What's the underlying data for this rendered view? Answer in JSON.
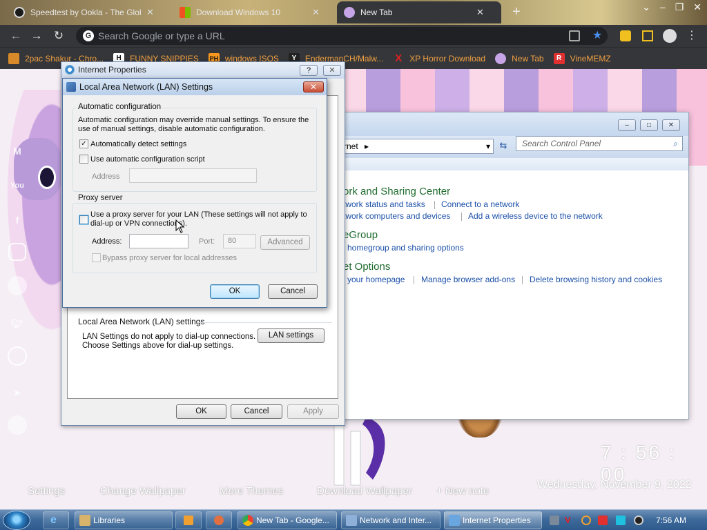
{
  "browser": {
    "tabs": [
      {
        "title": "Speedtest by Ookla - The Globa",
        "close": "✕"
      },
      {
        "title": "Download Windows 10",
        "close": "✕"
      },
      {
        "title": "New Tab",
        "close": "✕"
      }
    ],
    "new_tab": "+",
    "omnibox_placeholder": "Search Google or type a URL",
    "bookmarks": [
      {
        "label": "2pac Shakur - Chro...",
        "icon": "crown-icon"
      },
      {
        "label": "FUNNY SNIPPIES",
        "icon": "H"
      },
      {
        "label": "windows ISOS",
        "icon": "PH"
      },
      {
        "label": "EndermanCH/Malw...",
        "icon": "Y"
      },
      {
        "label": "XP Horror Download",
        "icon": "X"
      },
      {
        "label": "New Tab",
        "icon": "pony-icon"
      },
      {
        "label": "VineMEMZ",
        "icon": "R"
      }
    ]
  },
  "newtab_page": {
    "bottom_links": [
      "Settings",
      "Change Wallpaper",
      "More Themes",
      "Download Wallpaper",
      "+ New note"
    ],
    "clock": "7 : 56 : 00",
    "date": "Wednesday, November 9, 2022"
  },
  "control_panel": {
    "address_segment": "rnet",
    "search_placeholder": "Search Control Panel",
    "sections": [
      {
        "heading": "ork and Sharing Center",
        "links": [
          "twork status and tasks",
          "Connect to a network",
          "twork computers and devices",
          "Add a wireless device to the network"
        ]
      },
      {
        "heading": "eGroup",
        "links": [
          "homegroup and sharing options"
        ]
      },
      {
        "heading": "et Options",
        "links": [
          "your homepage",
          "Manage browser add-ons",
          "Delete browsing history and cookies"
        ]
      }
    ]
  },
  "internet_properties": {
    "title": "Internet Properties",
    "help": "?",
    "close": "✕",
    "lan_group_title": "Local Area Network (LAN) settings",
    "lan_text_1": "LAN Settings do not apply to dial-up connections.",
    "lan_text_2": "Choose Settings above for dial-up settings.",
    "lan_settings_button": "LAN settings",
    "ok": "OK",
    "cancel": "Cancel",
    "apply": "Apply"
  },
  "lan_dialog": {
    "title": "Local Area Network (LAN) Settings",
    "close": "✕",
    "auto_group": "Automatic configuration",
    "auto_text_1": "Automatic configuration may override manual settings.  To ensure the",
    "auto_text_2": "use of manual settings, disable automatic configuration.",
    "auto_detect_label": "Automatically detect settings",
    "auto_detect_checked": true,
    "script_label": "Use automatic configuration script",
    "script_checked": false,
    "address_label": "Address",
    "address_value": "",
    "proxy_group": "Proxy server",
    "proxy_label_1": "Use a proxy server for your LAN (These settings will not apply to",
    "proxy_label_2": "dial-up or VPN connections).",
    "proxy_checked": false,
    "proxy_address_label": "Address:",
    "proxy_address_value": "",
    "port_label": "Port:",
    "port_value": "80",
    "advanced": "Advanced",
    "bypass_label": "Bypass proxy server for local addresses",
    "ok": "OK",
    "cancel": "Cancel"
  },
  "taskbar": {
    "buttons": [
      "Libraries",
      "New Tab - Google...",
      "Network and Inter...",
      "Internet Properties"
    ],
    "time": "7:56 AM"
  }
}
